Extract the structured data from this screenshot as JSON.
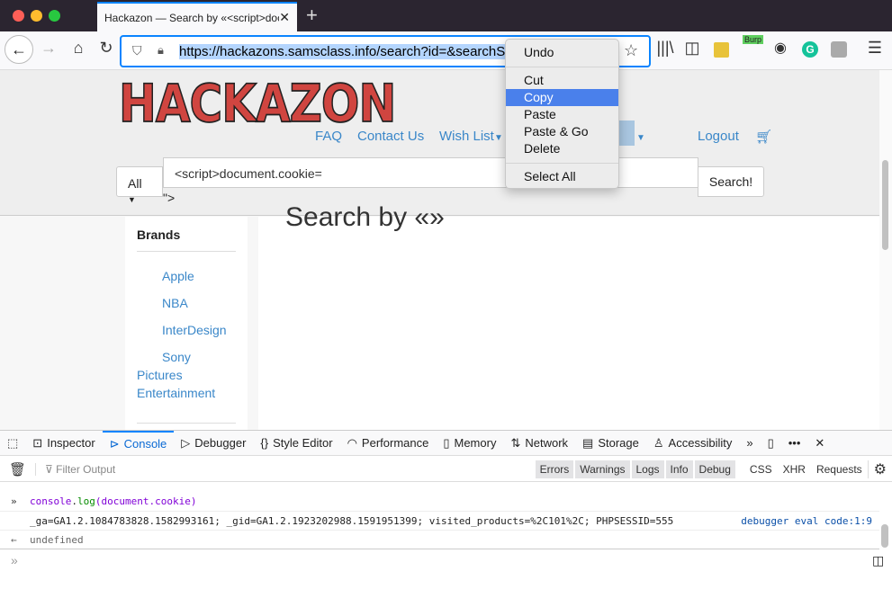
{
  "browser": {
    "tab_title": "Hackazon — Search by «<script>document.cookie=",
    "url": "https://hackazons.samsclass.info/search?id=&searchString="
  },
  "toolbar": {
    "burp_label": "Burp"
  },
  "page": {
    "logo": "HACKAZON",
    "nav": [
      "FAQ",
      "Contact Us",
      "Wish List",
      "Logout"
    ],
    "category": "All",
    "search_value": "<script>document.cookie=",
    "overflow_text": "\">",
    "search_button": "Search!",
    "heading": "Search by «»",
    "brands_title": "Brands",
    "brands": [
      "Apple",
      "NBA",
      "InterDesign",
      "Sony"
    ],
    "brand_wrap": [
      "Pictures",
      "Entertainment"
    ]
  },
  "context_menu": {
    "items": [
      "Undo",
      "Cut",
      "Copy",
      "Paste",
      "Paste & Go",
      "Delete",
      "Select All"
    ],
    "selected": "Copy"
  },
  "devtools": {
    "tabs": [
      "Inspector",
      "Console",
      "Debugger",
      "Style Editor",
      "Performance",
      "Memory",
      "Network",
      "Storage",
      "Accessibility"
    ],
    "active_tab": "Console",
    "filter_placeholder": "Filter Output",
    "levels": [
      "Errors",
      "Warnings",
      "Logs",
      "Info",
      "Debug"
    ],
    "types": [
      "CSS",
      "XHR",
      "Requests"
    ],
    "console": {
      "input_obj": "console",
      "input_dot": ".",
      "input_fn": "log",
      "input_arg": "(document.cookie)",
      "output": "_ga=GA1.2.1084783828.1582993161; _gid=GA1.2.1923202988.1591951399; visited_products=%2C101%2C; PHPSESSID=555",
      "source": "debugger eval code:1:9",
      "result": "undefined"
    }
  }
}
